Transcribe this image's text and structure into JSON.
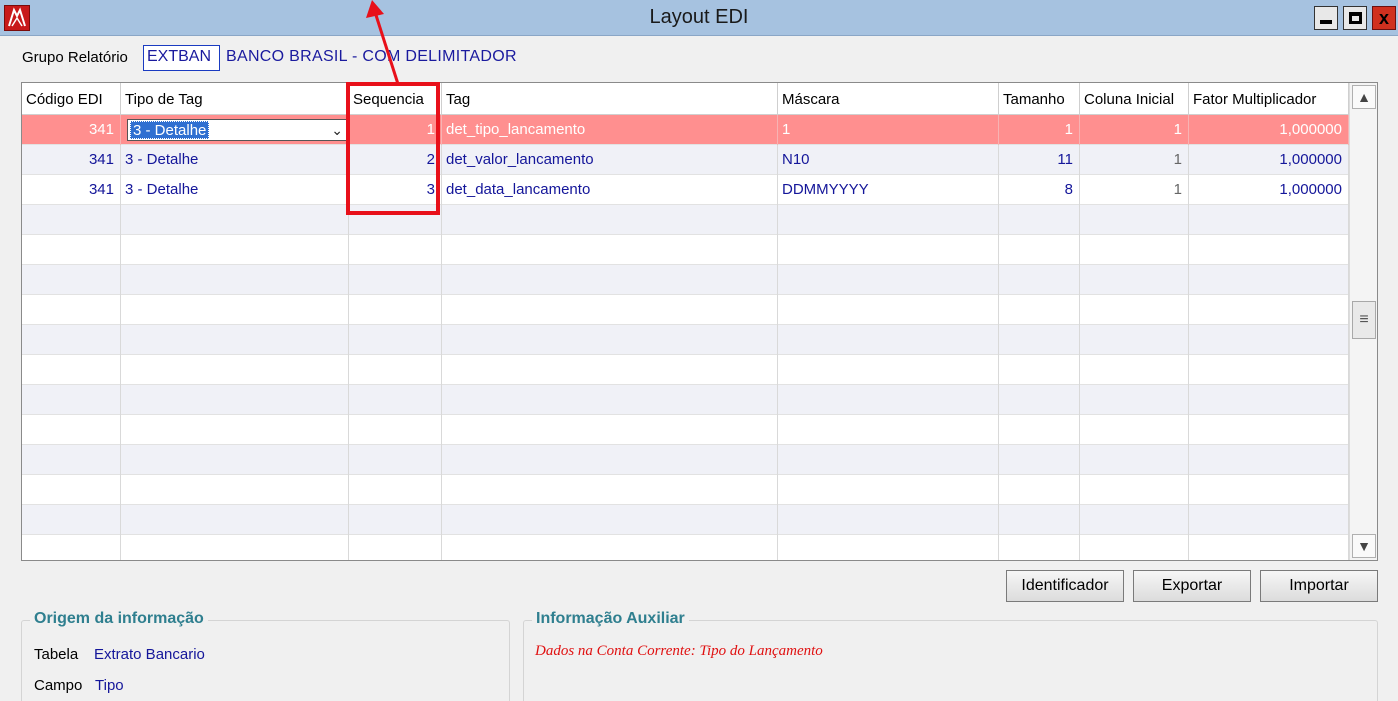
{
  "window": {
    "title": "Layout EDI",
    "close_glyph": "x"
  },
  "grupo": {
    "label": "Grupo Relatório",
    "code": "EXTBAN",
    "name": "BANCO BRASIL - COM DELIMITADOR"
  },
  "grid": {
    "headers": [
      "Código EDI",
      "Tipo de Tag",
      "Sequencia",
      "Tag",
      "Máscara",
      "Tamanho",
      "Coluna Inicial",
      "Fator Multiplicador"
    ],
    "rows": [
      {
        "codigo": "341",
        "tipo": "3 - Detalhe",
        "sequencia": "1",
        "tag": "det_tipo_lancamento",
        "mascara": "1",
        "tamanho": "1",
        "coluna_inicial": "1",
        "fator": "1,000000"
      },
      {
        "codigo": "341",
        "tipo": "3 - Detalhe",
        "sequencia": "2",
        "tag": "det_valor_lancamento",
        "mascara": "N10",
        "tamanho": "11",
        "coluna_inicial": "1",
        "fator": "1,000000"
      },
      {
        "codigo": "341",
        "tipo": "3 - Detalhe",
        "sequencia": "3",
        "tag": "det_data_lancamento",
        "mascara": "DDMMYYYY",
        "tamanho": "8",
        "coluna_inicial": "1",
        "fator": "1,000000"
      }
    ],
    "selected_row": 0,
    "scrollbar": {
      "up": "▲",
      "down": "▼",
      "thumb": "≡"
    }
  },
  "buttons": {
    "identificador": "Identificador",
    "exportar": "Exportar",
    "importar": "Importar"
  },
  "origem": {
    "title": "Origem da informação",
    "tabela_label": "Tabela",
    "tabela_value": "Extrato Bancario",
    "campo_label": "Campo",
    "campo_value": "Tipo"
  },
  "auxiliar": {
    "title": "Informação Auxiliar",
    "text": "Dados na Conta Corrente: Tipo do Lançamento"
  },
  "colors": {
    "selected_row": "#ff8f8f",
    "value_text": "#14169a",
    "annotation": "#e8101a",
    "group_title": "#2f7f8f"
  }
}
